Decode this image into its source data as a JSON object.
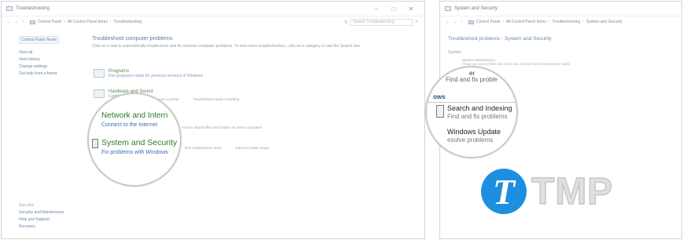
{
  "left_window": {
    "title": "Troubleshooting",
    "controls": {
      "minimize": "–",
      "maximize": "□",
      "close": "✕"
    },
    "breadcrumb": [
      "Control Panel",
      "All Control Panel Items",
      "Troubleshooting"
    ],
    "search_placeholder": "Search Troubleshooting",
    "sidebar": {
      "home": "Control Panel Home",
      "links": [
        "View all",
        "View history",
        "Change settings",
        "Get help from a friend"
      ],
      "see_also_label": "See also",
      "see_also": [
        "Security and Maintenance",
        "Help and Support",
        "Recovery"
      ]
    },
    "heading": "Troubleshoot computer problems",
    "description": "Click on a task to automatically troubleshoot and fix common computer problems. To view more troubleshooters, click on a category or use the Search box.",
    "categories": {
      "programs": {
        "title": "Programs",
        "sub": "Run programs made for previous versions of Windows"
      },
      "hardware": {
        "title": "Hardware and Sound",
        "sub": "Configure a device",
        "extra_1": "Use a printer",
        "extra_2": "Troubleshoot audio recording"
      },
      "network": {
        "title": "Network and Internet",
        "sub": "Connect to the Internet",
        "extra_1": "Access shared files and folders on other computers"
      },
      "system": {
        "title": "System and Security",
        "sub": "Fix problems with Windows",
        "extra_1": "Run maintenance tasks",
        "extra_2": "Improve power usage"
      }
    }
  },
  "right_window": {
    "title": "System and Security",
    "breadcrumb": [
      "Control Panel",
      "All Control Panel Items",
      "Troubleshooting",
      "System and Security"
    ],
    "heading": "Troubleshoot problems - System and Security",
    "section_system": "System",
    "items": {
      "maintenance": {
        "title": "System Maintenance",
        "sub": "Clean up unused files and shortcuts, and perform maintenance tasks"
      },
      "search_indexing": {
        "title": "Search and Indexing",
        "sub": "Find and fix problems"
      },
      "windows_update": {
        "title": "Windows Update",
        "sub": "Resolve problems"
      }
    }
  },
  "magnifier_left": {
    "network_title": "Network and Intern",
    "network_sub": "Connect to the Internet",
    "system_title": "System and Security",
    "system_sub": "Fix problems with Windows"
  },
  "magnifier_right": {
    "header_tail": "er",
    "find_fix_1": "Find and fix proble",
    "section": "ows",
    "search_title": "Search and Indexing",
    "search_sub": "Find and fix problems",
    "wu_title": "Windows Update",
    "wu_sub": "esolve problems"
  },
  "watermark": {
    "logo_letter": "T",
    "text": "TMP",
    "colors": {
      "logo": "#1e8fe0"
    }
  }
}
